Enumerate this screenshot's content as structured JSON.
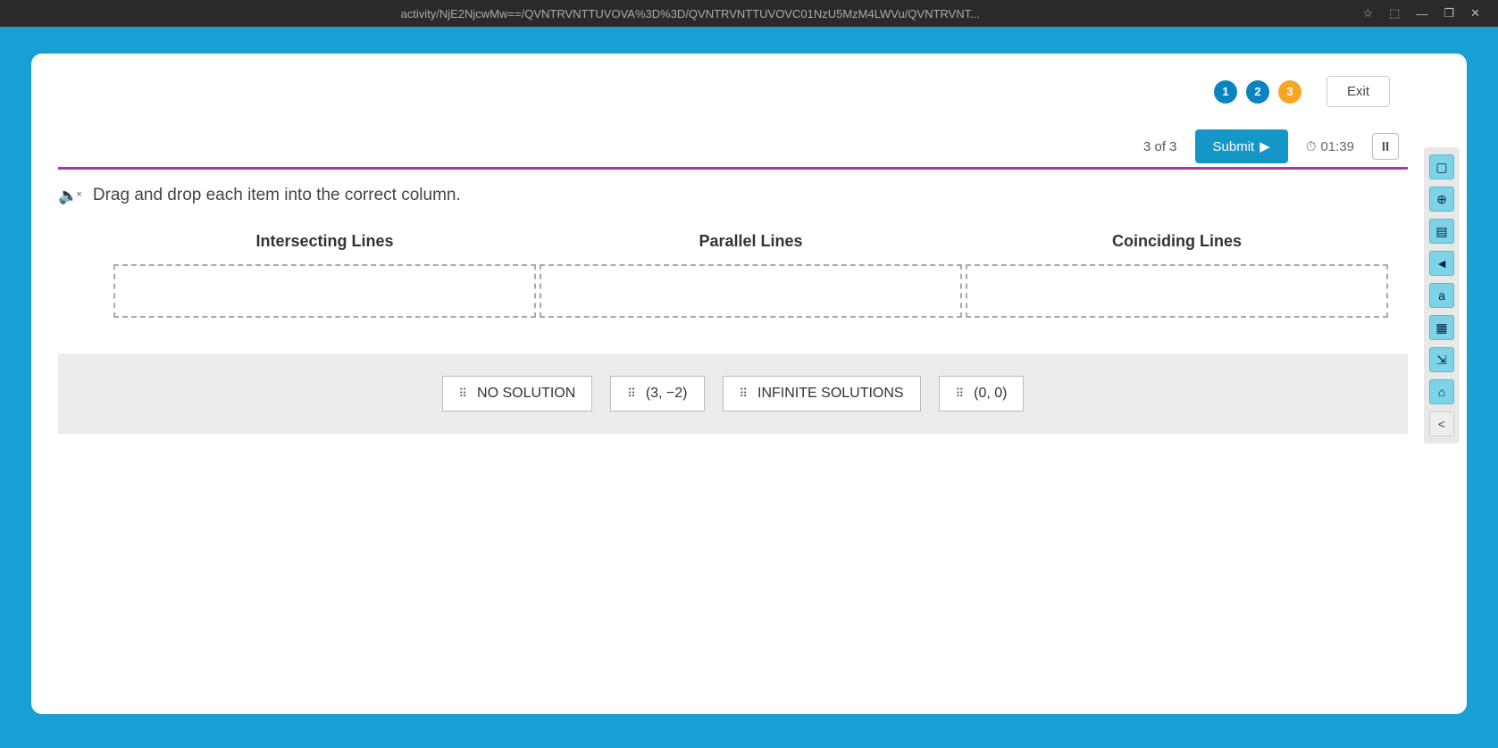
{
  "browser": {
    "url_fragment": "activity/NjE2NjcwMw==/QVNTRVNTTUVOVA%3D%3D/QVNTRVNTTUVOVC01NzU5MzM4LWVu/QVNTRVNT...",
    "window_controls": {
      "min": "—",
      "restore": "❐",
      "close": "✕"
    },
    "star": "☆",
    "ext": "⬚"
  },
  "header": {
    "steps": [
      "1",
      "2",
      "3"
    ],
    "exit_label": "Exit"
  },
  "status": {
    "progress_label": "3 of 3",
    "submit_label": "Submit",
    "submit_arrow": "▶",
    "timer_icon": "⏱",
    "timer_value": "01:39",
    "pause_label": "II"
  },
  "instruction": {
    "sound_icon": "🔈",
    "sound_x": "×",
    "text": "Drag and drop each item into the correct column."
  },
  "columns": [
    {
      "header": "Intersecting Lines"
    },
    {
      "header": "Parallel Lines"
    },
    {
      "header": "Coinciding Lines"
    }
  ],
  "chips": [
    "NO SOLUTION",
    "(3, −2)",
    "INFINITE SOLUTIONS",
    "(0, 0)"
  ],
  "side_tools": {
    "items": [
      "▢",
      "⊕",
      "▤",
      "◄",
      "a",
      "▦",
      "⇲",
      "⌂"
    ],
    "collapse": "<"
  }
}
